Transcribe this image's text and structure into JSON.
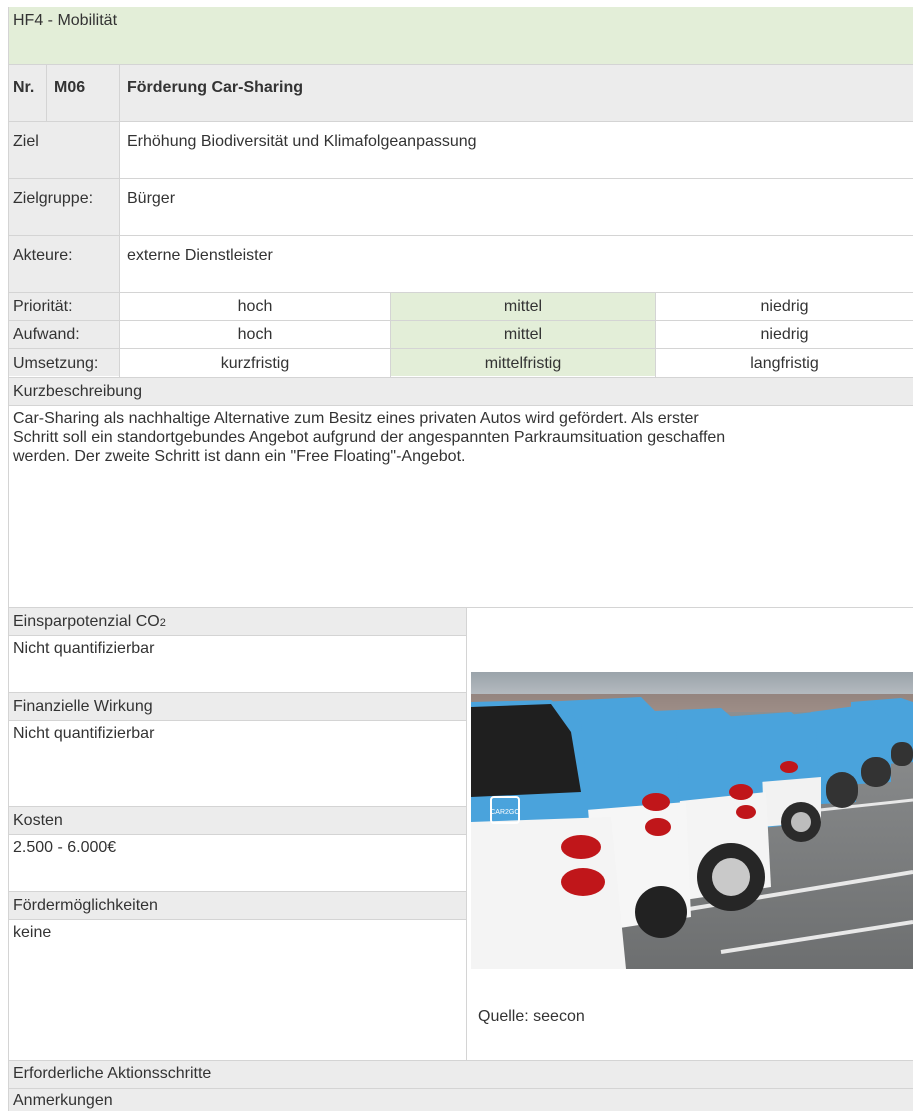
{
  "header": {
    "title": "HF4 - Mobilität"
  },
  "measure": {
    "nr_label": "Nr.",
    "code": "M06",
    "title": "Förderung Car-Sharing"
  },
  "ziel": {
    "label": "Ziel",
    "value": "Erhöhung Biodiversität und Klimafolgeanpassung"
  },
  "zielgruppe": {
    "label": "Zielgruppe:",
    "value": "Bürger"
  },
  "akteure": {
    "label": "Akteure:",
    "value": "externe Dienstleister"
  },
  "ratings": [
    {
      "label": "Priorität:",
      "options": [
        "hoch",
        "mittel",
        "niedrig"
      ],
      "selected": "mittel"
    },
    {
      "label": "Aufwand:",
      "options": [
        "hoch",
        "mittel",
        "niedrig"
      ],
      "selected": "mittel"
    },
    {
      "label": "Umsetzung:",
      "options": [
        "kurzfristig",
        "mittelfristig",
        "langfristig"
      ],
      "selected": "mittelfristig"
    }
  ],
  "kurzbeschreibung": {
    "label": "Kurzbeschreibung",
    "lines": [
      "Car-Sharing als nachhaltige Alternative zum Besitz eines privaten Autos wird gefördert. Als erster",
      "Schritt soll ein standortgebundes Angebot aufgrund der angespannten Parkraumsituation geschaffen",
      "werden. Der zweite Schritt ist dann ein \"Free Floating\"-Angebot."
    ]
  },
  "einsparpotenzial": {
    "label": "Einsparpotenzial CO",
    "label_sub": "2",
    "value": "Nicht quantifizierbar"
  },
  "finanzielle_wirkung": {
    "label": "Finanzielle Wirkung",
    "value": "Nicht quantifizierbar"
  },
  "kosten": {
    "label": "Kosten",
    "value": "2.500 - 6.000€"
  },
  "foerdermoeglichkeiten": {
    "label": "Fördermöglichkeiten",
    "value": "keine"
  },
  "image": {
    "caption": "Quelle: seecon",
    "car_badge_text": "CAR2GO"
  },
  "aktionsschritte": {
    "label": "Erforderliche Aktionsschritte"
  },
  "anmerkungen": {
    "label": "Anmerkungen"
  },
  "colors": {
    "header_green": "#e3eed8",
    "row_gray": "#ececec",
    "line_gray": "#d4d4d4",
    "car_blue": "#4aa3dc"
  }
}
